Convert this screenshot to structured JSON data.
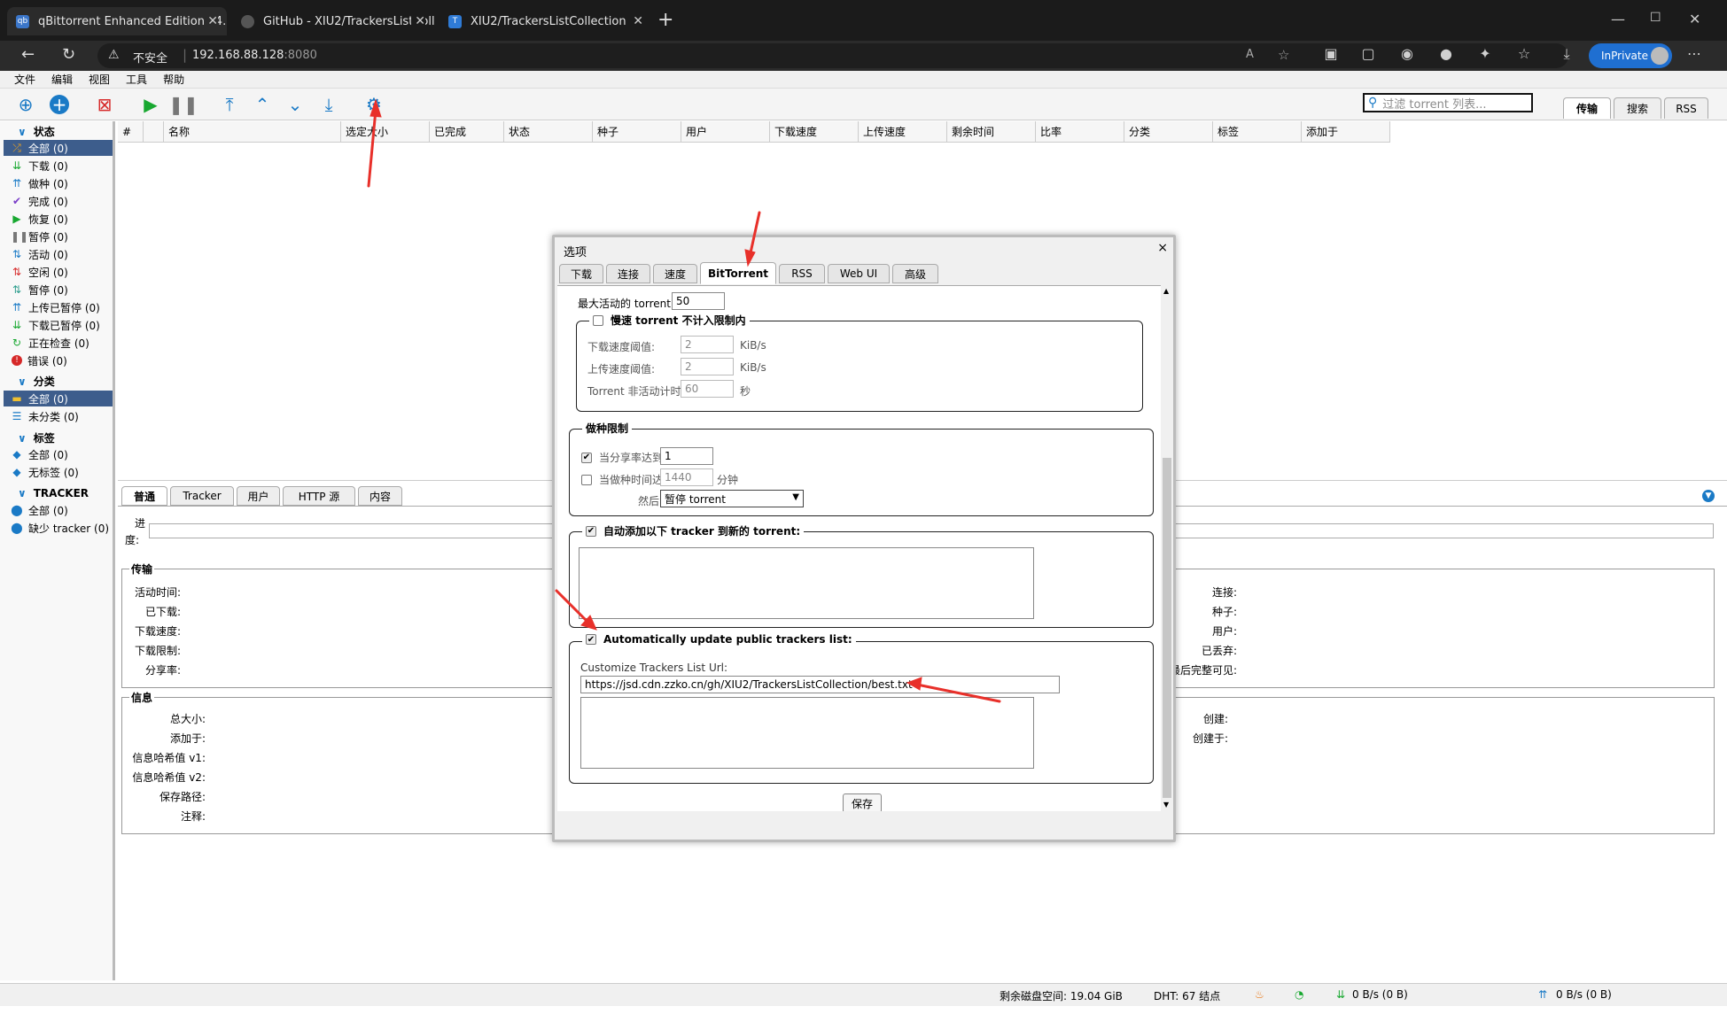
{
  "browser": {
    "tabs": [
      "qBittorrent Enhanced Edition v4.",
      "GitHub - XIU2/TrackersListCollec",
      "XIU2/TrackersListCollection"
    ],
    "security_label": "不安全",
    "url_host": "192.168.88.128",
    "url_port": ":8080",
    "inprivate_label": "InPrivate"
  },
  "menu": [
    "文件",
    "编辑",
    "视图",
    "工具",
    "帮助"
  ],
  "toolbar": {
    "filter_placeholder": "过滤 torrent 列表...",
    "right_tabs": [
      "传输",
      "搜索",
      "RSS"
    ]
  },
  "sidebar": {
    "status_header": "状态",
    "status_items": [
      "全部 (0)",
      "下载 (0)",
      "做种 (0)",
      "完成 (0)",
      "恢复 (0)",
      "暂停 (0)",
      "活动 (0)",
      "空闲 (0)",
      "暂停 (0)",
      "上传已暂停 (0)",
      "下载已暂停 (0)",
      "正在检查 (0)",
      "错误 (0)"
    ],
    "category_header": "分类",
    "category_items": [
      "全部 (0)",
      "未分类 (0)"
    ],
    "tag_header": "标签",
    "tag_items": [
      "全部 (0)",
      "无标签 (0)"
    ],
    "tracker_header": "TRACKER",
    "tracker_items": [
      "全部 (0)",
      "缺少 tracker (0)"
    ]
  },
  "table": {
    "columns": [
      "#",
      "",
      "名称",
      "选定大小",
      "已完成",
      "状态",
      "种子",
      "用户",
      "下载速度",
      "上传速度",
      "剩余时间",
      "比率",
      "分类",
      "标签",
      "添加于"
    ]
  },
  "details": {
    "tabs": [
      "普通",
      "Tracker",
      "用户",
      "HTTP 源",
      "内容"
    ],
    "progress_label_1": "进",
    "progress_label_2": "度:",
    "transfer_title": "传输",
    "transfer_left": [
      "活动时间:",
      "已下载:",
      "下载速度:",
      "下载限制:",
      "分享率:"
    ],
    "transfer_right": [
      "连接:",
      "种子:",
      "用户:",
      "已丢弃:",
      "最后完整可见:"
    ],
    "info_title": "信息",
    "info_left": [
      "总大小:",
      "添加于:",
      "信息哈希值 v1:",
      "信息哈希值 v2:",
      "保存路径:",
      "注释:"
    ],
    "info_right": [
      "创建:",
      "创建于:"
    ]
  },
  "statusbar": {
    "disk": "剩余磁盘空间: 19.04 GiB",
    "dht": "DHT: 67 结点",
    "down": "0 B/s (0 B)",
    "up": "0 B/s (0 B)"
  },
  "dialog": {
    "title": "选项",
    "close": "×",
    "tabs": [
      "下载",
      "连接",
      "速度",
      "BitTorrent",
      "RSS",
      "Web UI",
      "高级"
    ],
    "max_active_label": "最大活动的 torrent 数:",
    "max_active_value": "50",
    "slow_title": "慢速 torrent 不计入限制内",
    "dl_threshold_label": "下载速度阈值:",
    "dl_threshold_value": "2",
    "ul_threshold_label": "上传速度阈值:",
    "ul_threshold_value": "2",
    "kib": "KiB/s",
    "inactive_label": "Torrent 非活动计时器:",
    "inactive_value": "60",
    "sec": "秒",
    "seed_title": "做种限制",
    "ratio_label": "当分享率达到",
    "ratio_value": "1",
    "time_label": "当做种时间达到",
    "time_value": "1440",
    "minutes": "分钟",
    "then_label": "然后",
    "then_value": "暂停 torrent",
    "auto_add_title": "自动添加以下 tracker 到新的 torrent:",
    "auto_update_title": "Automatically update public trackers list:",
    "custom_url_label": "Customize Trackers List Url:",
    "custom_url_value": "https://jsd.cdn.zzko.cn/gh/XIU2/TrackersListCollection/best.txt",
    "save": "保存"
  },
  "colors": {
    "accent": "#3d5d8c",
    "arrow": "#e8302a",
    "inprivate": "#1f6fd1"
  }
}
